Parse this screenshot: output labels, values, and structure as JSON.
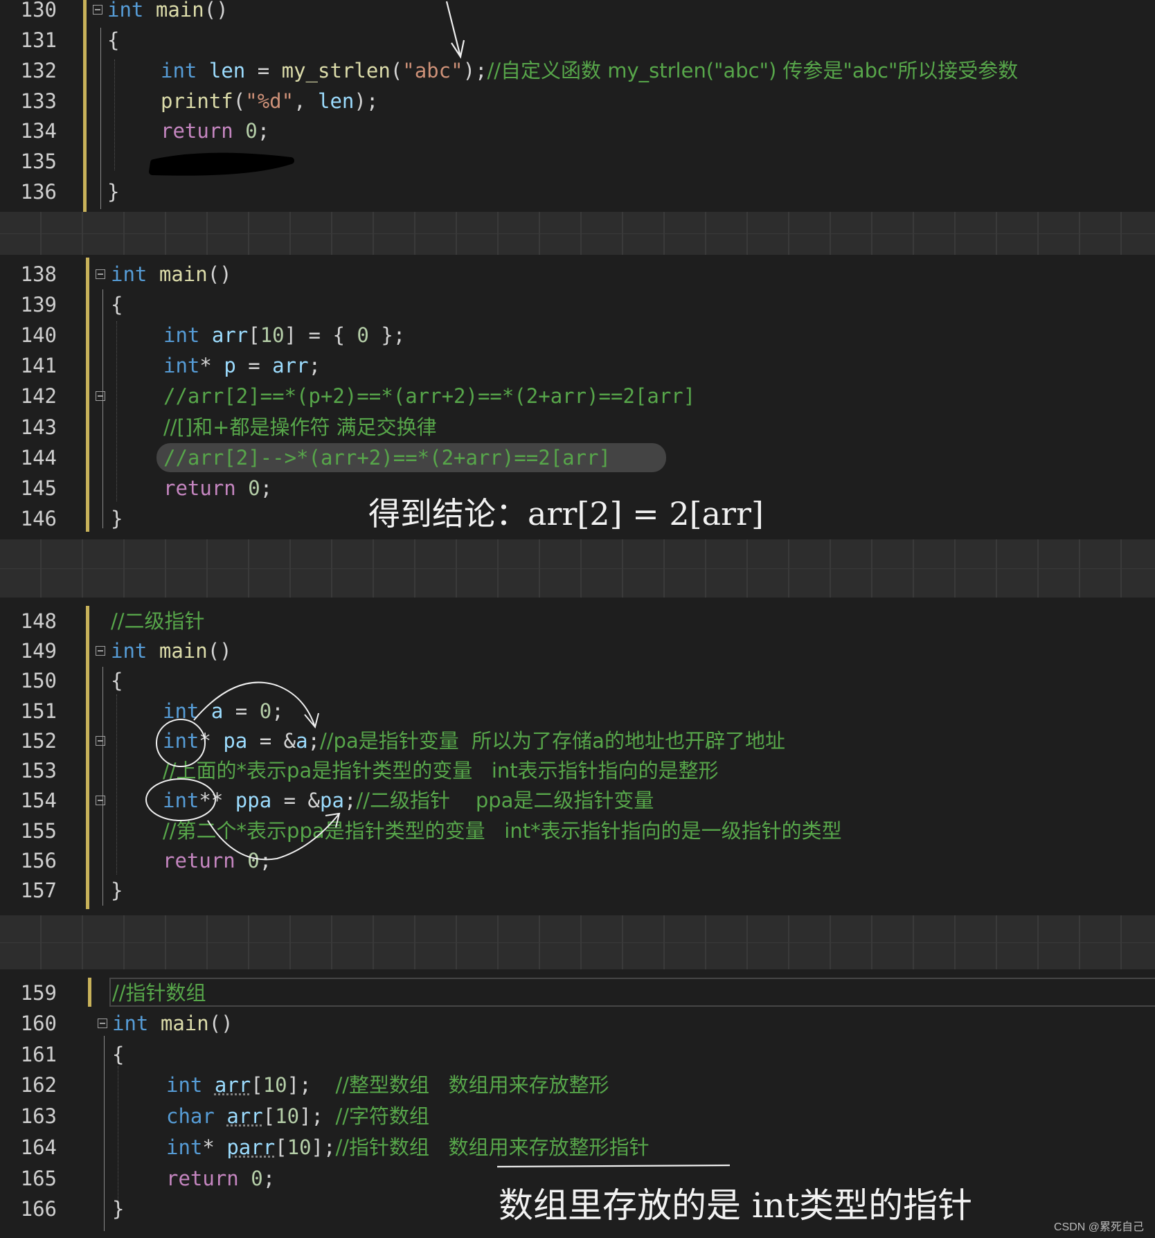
{
  "panels": [
    {
      "lines": [
        {
          "no": "130",
          "text": "int main()"
        },
        {
          "no": "131",
          "text": "{"
        },
        {
          "no": "132",
          "text": "int len = my_strlen(\"abc\");",
          "comment": "//自定义函数 my_strlen(\"abc\") 传参是\"abc\"所以接受参数"
        },
        {
          "no": "133",
          "text": "printf(\"%d\", len);"
        },
        {
          "no": "134",
          "text": "return 0;"
        },
        {
          "no": "135",
          "text": ""
        },
        {
          "no": "136",
          "text": "}"
        }
      ]
    },
    {
      "lines": [
        {
          "no": "138",
          "text": "int main()"
        },
        {
          "no": "139",
          "text": "{"
        },
        {
          "no": "140",
          "text": "int arr[10] = { 0 };"
        },
        {
          "no": "141",
          "text": "int* p = arr;"
        },
        {
          "no": "142",
          "text": "//arr[2]==*(p+2)==*(arr+2)==*(2+arr)==2[arr]"
        },
        {
          "no": "143",
          "text": "//[]和+都是操作符 满足交换律"
        },
        {
          "no": "144",
          "text": "//arr[2]-->*(arr+2)==*(2+arr)==2[arr]"
        },
        {
          "no": "145",
          "text": "return 0;"
        },
        {
          "no": "146",
          "text": "}"
        }
      ],
      "handwriting": "得到结论：arr[2] = 2[arr]"
    },
    {
      "lines": [
        {
          "no": "148",
          "text": "//二级指针"
        },
        {
          "no": "149",
          "text": "int main()"
        },
        {
          "no": "150",
          "text": "{"
        },
        {
          "no": "151",
          "text": "int a = 0;"
        },
        {
          "no": "152",
          "text": "int* pa = &a;",
          "comment": "//pa是指针变量  所以为了存储a的地址也开辟了地址"
        },
        {
          "no": "153",
          "text": "//上面的*表示pa是指针类型的变量   int表示指针指向的是整形"
        },
        {
          "no": "154",
          "text": "int** ppa = &pa;",
          "comment": "//二级指针    ppa是二级指针变量"
        },
        {
          "no": "155",
          "text": "//第二个*表示ppa是指针类型的变量   int*表示指针指向的是一级指针的类型"
        },
        {
          "no": "156",
          "text": "return 0;"
        },
        {
          "no": "157",
          "text": "}"
        }
      ]
    },
    {
      "lines": [
        {
          "no": "159",
          "text": "//指针数组"
        },
        {
          "no": "160",
          "text": "int main()"
        },
        {
          "no": "161",
          "text": "{"
        },
        {
          "no": "162",
          "text": "int arr[10];",
          "comment": "//整型数组   数组用来存放整形"
        },
        {
          "no": "163",
          "text": "char arr[10];",
          "comment": "//字符数组"
        },
        {
          "no": "164",
          "text": "int* parr[10];",
          "comment": "//指针数组   数组用来存放整形指针"
        },
        {
          "no": "165",
          "text": "return 0;"
        },
        {
          "no": "166",
          "text": "}"
        }
      ],
      "handwriting": "数组里存放的是 int类型的指针"
    }
  ],
  "watermark": "CSDN @累死自己",
  "colors": {
    "background": "#1e1e1e",
    "keyword": "#569cd6",
    "control": "#c586c0",
    "function": "#dcdcaa",
    "string": "#ce9178",
    "number": "#b5cea8",
    "variable": "#9cdcfe",
    "comment": "#57a64a",
    "change_bar": "#c8b25a"
  }
}
